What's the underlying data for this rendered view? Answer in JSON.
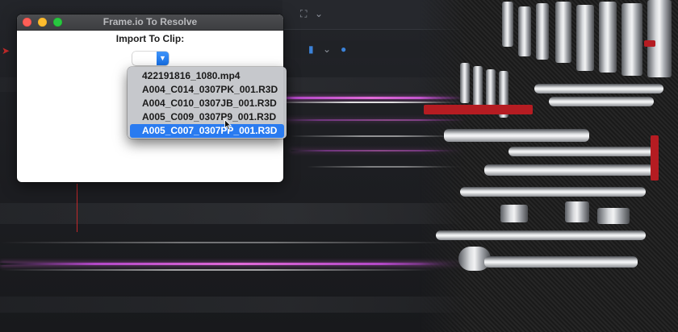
{
  "window": {
    "title": "Frame.io To Resolve",
    "prompt": "Import To Clip:",
    "popup_value": ""
  },
  "menu": {
    "items": [
      {
        "label": "422191816_1080.mp4",
        "selected": false
      },
      {
        "label": "A004_C014_0307PK_001.R3D",
        "selected": false
      },
      {
        "label": "A004_C010_0307JB_001.R3D",
        "selected": false
      },
      {
        "label": "A005_C009_0307P9_001.R3D",
        "selected": false
      },
      {
        "label": "A005_C007_0307PP_001.R3D",
        "selected": true
      }
    ]
  },
  "icons": {
    "popup_arrow": "chevron-down-icon",
    "cursor": "arrow-cursor-icon"
  },
  "colors": {
    "accent": "#2a7bf0",
    "close": "#fe5f57",
    "minimize": "#febc2e",
    "zoom": "#28c840"
  }
}
